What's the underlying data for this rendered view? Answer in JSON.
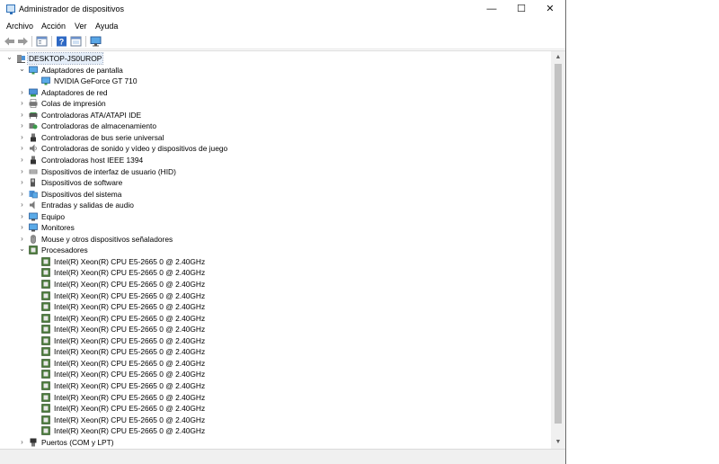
{
  "window": {
    "title": "Administrador de dispositivos"
  },
  "titlebar_buttons": {
    "minimize": "—",
    "maximize": "☐",
    "close": "✕"
  },
  "menu": [
    "Archivo",
    "Acción",
    "Ver",
    "Ayuda"
  ],
  "toolbar": [
    "back-icon",
    "forward-icon",
    "properties-icon",
    "help-icon",
    "view-icon",
    "monitor-icon"
  ],
  "tree": {
    "root": "DESKTOP-JS0UROP",
    "categories": [
      {
        "label": "Adaptadores de pantalla",
        "expanded": true,
        "icon": "display-adapter-icon",
        "children": [
          "NVIDIA GeForce GT 710"
        ]
      },
      {
        "label": "Adaptadores de red",
        "expanded": false,
        "icon": "network-adapter-icon"
      },
      {
        "label": "Colas de impresión",
        "expanded": false,
        "icon": "printer-icon"
      },
      {
        "label": "Controladoras ATA/ATAPI IDE",
        "expanded": false,
        "icon": "ide-controller-icon"
      },
      {
        "label": "Controladoras de almacenamiento",
        "expanded": false,
        "icon": "storage-controller-icon"
      },
      {
        "label": "Controladoras de bus serie universal",
        "expanded": false,
        "icon": "usb-icon"
      },
      {
        "label": "Controladoras de sonido y vídeo y dispositivos de juego",
        "expanded": false,
        "icon": "sound-icon"
      },
      {
        "label": "Controladoras host IEEE 1394",
        "expanded": false,
        "icon": "ieee1394-icon"
      },
      {
        "label": "Dispositivos de interfaz de usuario (HID)",
        "expanded": false,
        "icon": "hid-icon"
      },
      {
        "label": "Dispositivos de software",
        "expanded": false,
        "icon": "software-device-icon"
      },
      {
        "label": "Dispositivos del sistema",
        "expanded": false,
        "icon": "system-device-icon"
      },
      {
        "label": "Entradas y salidas de audio",
        "expanded": false,
        "icon": "audio-io-icon"
      },
      {
        "label": "Equipo",
        "expanded": false,
        "icon": "computer-icon"
      },
      {
        "label": "Monitores",
        "expanded": false,
        "icon": "monitor-icon"
      },
      {
        "label": "Mouse y otros dispositivos señaladores",
        "expanded": false,
        "icon": "mouse-icon"
      },
      {
        "label": "Procesadores",
        "expanded": true,
        "icon": "processor-icon",
        "children": [
          "Intel(R) Xeon(R) CPU E5-2665 0 @ 2.40GHz",
          "Intel(R) Xeon(R) CPU E5-2665 0 @ 2.40GHz",
          "Intel(R) Xeon(R) CPU E5-2665 0 @ 2.40GHz",
          "Intel(R) Xeon(R) CPU E5-2665 0 @ 2.40GHz",
          "Intel(R) Xeon(R) CPU E5-2665 0 @ 2.40GHz",
          "Intel(R) Xeon(R) CPU E5-2665 0 @ 2.40GHz",
          "Intel(R) Xeon(R) CPU E5-2665 0 @ 2.40GHz",
          "Intel(R) Xeon(R) CPU E5-2665 0 @ 2.40GHz",
          "Intel(R) Xeon(R) CPU E5-2665 0 @ 2.40GHz",
          "Intel(R) Xeon(R) CPU E5-2665 0 @ 2.40GHz",
          "Intel(R) Xeon(R) CPU E5-2665 0 @ 2.40GHz",
          "Intel(R) Xeon(R) CPU E5-2665 0 @ 2.40GHz",
          "Intel(R) Xeon(R) CPU E5-2665 0 @ 2.40GHz",
          "Intel(R) Xeon(R) CPU E5-2665 0 @ 2.40GHz",
          "Intel(R) Xeon(R) CPU E5-2665 0 @ 2.40GHz",
          "Intel(R) Xeon(R) CPU E5-2665 0 @ 2.40GHz"
        ]
      },
      {
        "label": "Puertos (COM y LPT)",
        "expanded": false,
        "icon": "port-icon"
      }
    ]
  },
  "colors": {
    "selection": "#e5eef9",
    "scroll_thumb": "#c2c2c2",
    "border": "#6b6b6b"
  }
}
